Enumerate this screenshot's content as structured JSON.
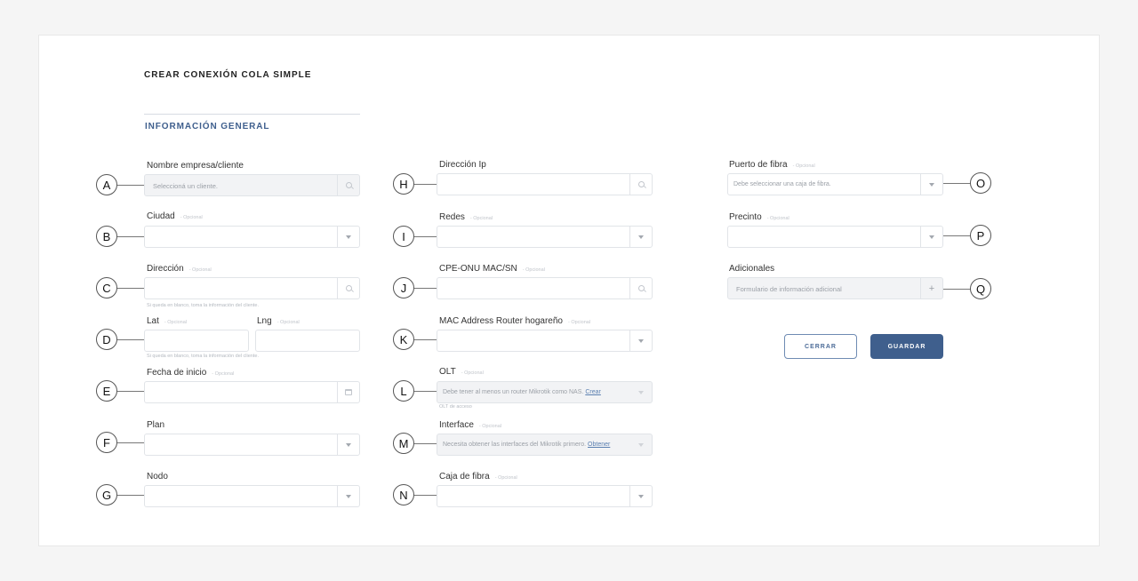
{
  "header": {
    "title": "CREAR CONEXIÓN COLA SIMPLE",
    "section": "INFORMACIÓN GENERAL"
  },
  "optional_tag": "- Opcional",
  "callouts": [
    "A",
    "B",
    "C",
    "D",
    "E",
    "F",
    "G",
    "H",
    "I",
    "J",
    "K",
    "L",
    "M",
    "N",
    "O",
    "P",
    "Q"
  ],
  "fields": {
    "cliente": {
      "label": "Nombre empresa/cliente",
      "placeholder": "Seleccioná un cliente.",
      "icon": "search-icon"
    },
    "ciudad": {
      "label": "Ciudad",
      "optional": true,
      "icon": "chevron-down-icon"
    },
    "direccion": {
      "label": "Dirección",
      "optional": true,
      "icon": "search-icon",
      "hint": "Si queda en blanco, toma la información del cliente."
    },
    "lat": {
      "label": "Lat",
      "optional": true
    },
    "lng": {
      "label": "Lng",
      "optional": true,
      "hint": "Si queda en blanco, toma la información del cliente."
    },
    "fecha_inicio": {
      "label": "Fecha de inicio",
      "optional": true,
      "icon": "calendar-icon"
    },
    "plan": {
      "label": "Plan",
      "icon": "chevron-down-icon"
    },
    "nodo": {
      "label": "Nodo",
      "icon": "chevron-down-icon"
    },
    "direccion_ip": {
      "label": "Dirección Ip",
      "icon": "search-icon"
    },
    "redes": {
      "label": "Redes",
      "optional": true,
      "icon": "chevron-down-icon"
    },
    "cpe_onu": {
      "label": "CPE-ONU MAC/SN",
      "optional": true,
      "icon": "search-icon"
    },
    "mac_router": {
      "label": "MAC Address Router hogareño",
      "optional": true,
      "icon": "chevron-down-icon"
    },
    "olt": {
      "label": "OLT",
      "optional": true,
      "placeholder": "Debe tener al menos un router Mikrotik como NAS.",
      "link": "Crear",
      "hint": "OLT de acceso",
      "icon": "chevron-down-icon"
    },
    "interface": {
      "label": "Interface",
      "optional": true,
      "placeholder": "Necesita obtener las interfaces del Mikrotik primero.",
      "link": "Obtener",
      "icon": "chevron-down-icon"
    },
    "caja_fibra": {
      "label": "Caja de fibra",
      "optional": true,
      "icon": "chevron-down-icon"
    },
    "puerto_fibra": {
      "label": "Puerto de fibra",
      "optional": true,
      "placeholder": "Debe seleccionar una caja de fibra.",
      "icon": "chevron-down-icon"
    },
    "precinto": {
      "label": "Precinto",
      "optional": true,
      "icon": "chevron-down-icon"
    },
    "adicionales": {
      "label": "Adicionales",
      "placeholder": "Formulario de información adicional",
      "icon": "plus-icon"
    }
  },
  "buttons": {
    "close": "CERRAR",
    "save": "GUARDAR"
  },
  "colors": {
    "primary": "#3f5f8d",
    "background": "#f5f5f5",
    "field_disabled": "#f2f3f5"
  }
}
